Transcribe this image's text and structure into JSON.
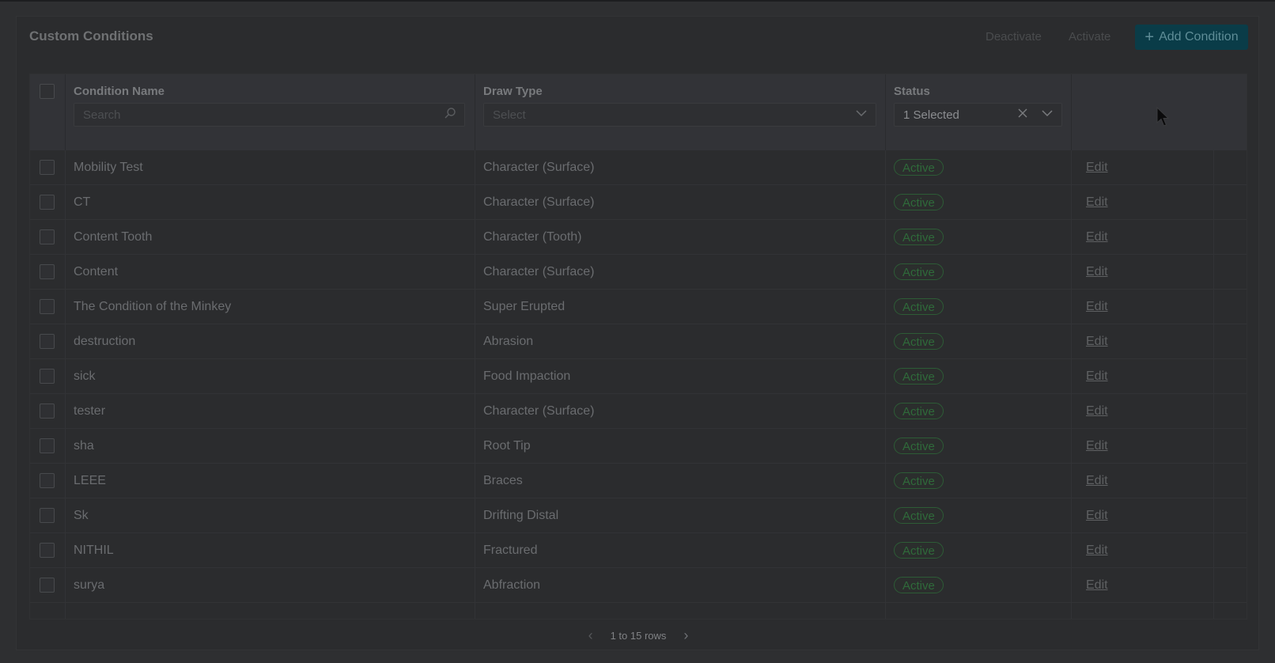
{
  "page": {
    "title": "Custom Conditions",
    "deactivate_label": "Deactivate",
    "activate_label": "Activate",
    "add_label": "Add Condition"
  },
  "columns": {
    "name": "Condition Name",
    "draw_type": "Draw Type",
    "status": "Status"
  },
  "filters": {
    "name_placeholder": "Search",
    "draw_type_placeholder": "Select",
    "status_value": "1 Selected"
  },
  "rows": [
    {
      "name": "Mobility Test",
      "draw_type": "Character (Surface)",
      "status": "Active",
      "action": "Edit"
    },
    {
      "name": "CT",
      "draw_type": "Character (Surface)",
      "status": "Active",
      "action": "Edit"
    },
    {
      "name": "Content Tooth",
      "draw_type": "Character (Tooth)",
      "status": "Active",
      "action": "Edit"
    },
    {
      "name": "Content",
      "draw_type": "Character (Surface)",
      "status": "Active",
      "action": "Edit"
    },
    {
      "name": "The Condition of the Minkey",
      "draw_type": "Super Erupted",
      "status": "Active",
      "action": "Edit"
    },
    {
      "name": "destruction",
      "draw_type": "Abrasion",
      "status": "Active",
      "action": "Edit"
    },
    {
      "name": "sick",
      "draw_type": "Food Impaction",
      "status": "Active",
      "action": "Edit"
    },
    {
      "name": "tester",
      "draw_type": "Character (Surface)",
      "status": "Active",
      "action": "Edit"
    },
    {
      "name": "sha",
      "draw_type": "Root Tip",
      "status": "Active",
      "action": "Edit"
    },
    {
      "name": "LEEE",
      "draw_type": "Braces",
      "status": "Active",
      "action": "Edit"
    },
    {
      "name": "Sk",
      "draw_type": "Drifting Distal",
      "status": "Active",
      "action": "Edit"
    },
    {
      "name": "NITHIL",
      "draw_type": "Fractured",
      "status": "Active",
      "action": "Edit"
    },
    {
      "name": "surya",
      "draw_type": "Abfraction",
      "status": "Active",
      "action": "Edit"
    }
  ],
  "pagination": {
    "info": "1 to 15 rows"
  },
  "colors": {
    "primary_button": "#0a3c48",
    "active_badge": "#2f6a3a",
    "overlay": "#2b2c2e"
  }
}
